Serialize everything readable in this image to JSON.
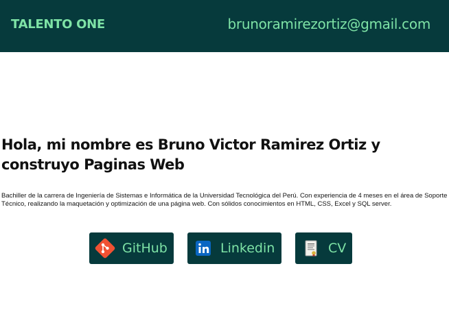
{
  "header": {
    "brand": "TALENTO ONE",
    "email": "brunoramirezortiz@gmail.com"
  },
  "intro": {
    "title": "Hola, mi nombre es Bruno Victor Ramirez Ortiz y construyo Paginas Web",
    "description": "Bachiller de la carrera de Ingeniería de Sistemas e Informática de la Universidad Tecnológica del Perú. Con experiencia de 4 meses en el área de Soporte Técnico, realizando la maquetación y optimización de una página web. Con sólidos conocimientos en HTML, CSS, Excel y SQL server."
  },
  "links": {
    "github_label": "GitHub",
    "linkedin_label": "Linkedin",
    "cv_label": "CV"
  },
  "icons": {
    "github": "git-icon",
    "linkedin": "linkedin-icon",
    "cv": "document-icon"
  },
  "colors": {
    "header_bg": "#063a3c",
    "accent": "#7ee3a6",
    "git_orange": "#f05133",
    "linkedin_blue": "#0a66c2"
  }
}
